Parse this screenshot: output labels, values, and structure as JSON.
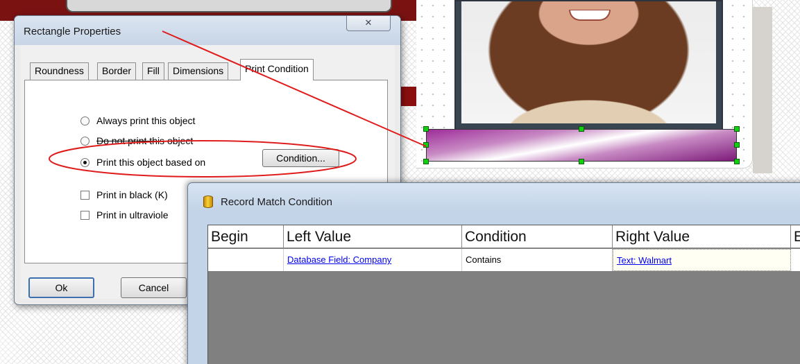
{
  "rectangle_properties": {
    "title": "Rectangle Properties",
    "close_label": "✕",
    "tabs": [
      {
        "label": "Roundness",
        "active": false
      },
      {
        "label": "Border",
        "active": false
      },
      {
        "label": "Fill",
        "active": false
      },
      {
        "label": "Dimensions",
        "active": false
      },
      {
        "label": "Print Condition",
        "active": true
      }
    ],
    "options": {
      "always_print": "Always print this object",
      "do_not_print": "Do not print this object",
      "print_based_on": "Print this object based on",
      "selected": "print_based_on"
    },
    "condition_button": "Condition...",
    "checkboxes": {
      "print_black": "Print in black (K)",
      "print_ultraviolet": "Print in ultraviole"
    },
    "buttons": {
      "ok": "Ok",
      "cancel": "Cancel"
    }
  },
  "record_match_condition": {
    "title": "Record Match Condition",
    "columns": [
      "Begin",
      "Left Value",
      "Condition",
      "Right Value",
      "E"
    ],
    "rows": [
      {
        "begin": "",
        "left_value": "Database Field: Company",
        "condition": "Contains",
        "right_value": "Text: Walmart"
      }
    ]
  },
  "colors": {
    "annotation": "#e01b1b",
    "handle": "#10d010",
    "selected_rect_fill": "#9e2d9a",
    "link": "#0000ee"
  }
}
